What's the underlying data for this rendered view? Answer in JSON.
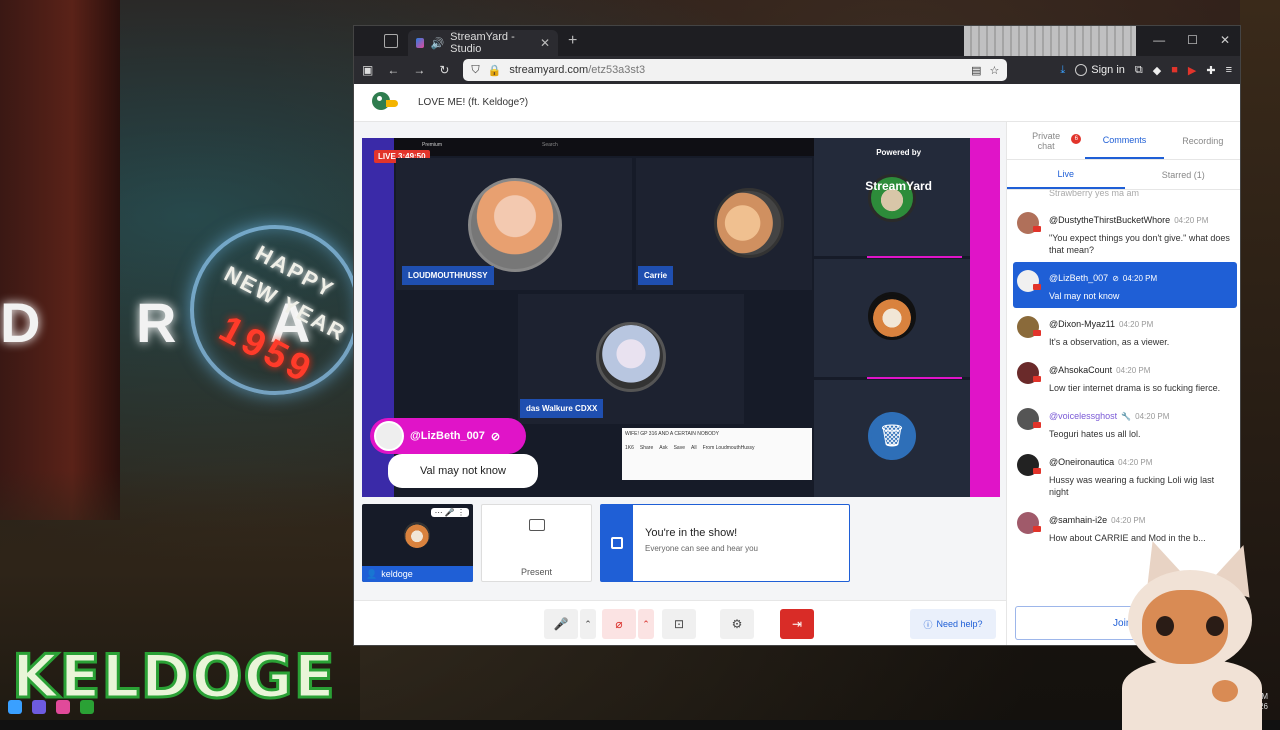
{
  "browser": {
    "tab_title": "StreamYard - Studio",
    "url_host": "streamyard.com",
    "url_path": "/etz53a3st3",
    "sign_in": "Sign in"
  },
  "studio": {
    "broadcast_title": "LOVE ME! (ft. Keldoge?)",
    "live_badge": "LIVE 3:49:50",
    "powered_by": "Powered by",
    "brand": "StreamYard",
    "participants": [
      {
        "name": "LOUDMOUTHHUSSY"
      },
      {
        "name": "Carrie"
      },
      {
        "name": "das Walkure CDXX"
      }
    ],
    "banner": {
      "user": "@LizBeth_007",
      "message": "Val may not know"
    },
    "stage_snippets": {
      "premium": "Premium",
      "search": "Search",
      "video_title": "WIFE! GP 316 AND A CERTAIN NOBODY",
      "from_label": "From LoudmouthHussy",
      "action_count": "1K6",
      "share": "Share",
      "ask": "Ask",
      "save": "Save",
      "all": "All"
    },
    "thumb_name": "keldoge",
    "present_label": "Present",
    "inshow_title": "You're in the show!",
    "inshow_sub": "Everyone can see and hear you",
    "need_help": "Need help?"
  },
  "chat": {
    "tabs": {
      "private": "Private chat",
      "private_count": "6",
      "comments": "Comments",
      "recording": "Recording"
    },
    "subtabs": {
      "live": "Live",
      "starred": "Starred (1)"
    },
    "partial_text": "Strawberry yes ma am",
    "messages": [
      {
        "user": "@DustytheThirstBucketWhore",
        "time": "04:20 PM",
        "text": "\"You expect things you don't give.\" what does that mean?"
      },
      {
        "user": "@LizBeth_007",
        "time": "04:20 PM",
        "text": "Val may not know"
      },
      {
        "user": "@Dixon-Myaz11",
        "time": "04:20 PM",
        "text": "It's a observation, as a viewer."
      },
      {
        "user": "@AhsokaCount",
        "time": "04:20 PM",
        "text": "Low tier internet drama is so fucking fierce."
      },
      {
        "user": "@voicelessghost",
        "time": "04:20 PM",
        "text": "Teoguri hates us all lol."
      },
      {
        "user": "@Oneironautica",
        "time": "04:20 PM",
        "text": "Hussy was wearing a fucking Loli wig last night"
      },
      {
        "user": "@samhain-i2e",
        "time": "04:20 PM",
        "text": "How about CARRIE and Mod in the b..."
      }
    ],
    "join_label": "Join t"
  },
  "overlay": {
    "streamer_logo": "KELDOGE",
    "sign_line1": "HAPPY",
    "sign_line2": "NEW YEAR",
    "sign_year": "1959",
    "bg_letters": "D R A",
    "clock_time": "PM",
    "clock_date": "14/2026"
  },
  "colors": {
    "accent": "#1f5fd6",
    "stage_border": "#e014c8",
    "live_red": "#e2342b"
  }
}
